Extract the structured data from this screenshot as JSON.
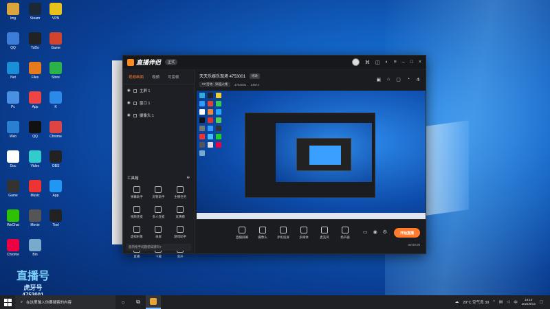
{
  "desktop": {
    "icons": [
      {
        "label": "Img",
        "color": "#d9a53c"
      },
      {
        "label": "Steam",
        "color": "#1b2838"
      },
      {
        "label": "VPN",
        "color": "#e8c21a"
      },
      {
        "label": "QQ",
        "color": "#3d7dd8"
      },
      {
        "label": "ToDo",
        "color": "#222"
      },
      {
        "label": "Game",
        "color": "#d4432c"
      },
      {
        "label": "Net",
        "color": "#1a8fd8"
      },
      {
        "label": "Files",
        "color": "#e87a1e"
      },
      {
        "label": "Store",
        "color": "#2bb34a"
      },
      {
        "label": "Pc",
        "color": "#4a90e2"
      },
      {
        "label": "App",
        "color": "#e44"
      },
      {
        "label": "K",
        "color": "#2b8ae8"
      },
      {
        "label": "Web",
        "color": "#2b7fd1"
      },
      {
        "label": "QQ",
        "color": "#111"
      },
      {
        "label": "Chrome",
        "color": "#d44"
      },
      {
        "label": "Doc",
        "color": "#fff"
      },
      {
        "label": "Video",
        "color": "#3cc"
      },
      {
        "label": "OBS",
        "color": "#222"
      },
      {
        "label": "Game",
        "color": "#333"
      },
      {
        "label": "Music",
        "color": "#e33"
      },
      {
        "label": "App",
        "color": "#2196f3"
      },
      {
        "label": "WeChat",
        "color": "#2dc100"
      },
      {
        "label": "Movie",
        "color": "#555"
      },
      {
        "label": "Tool",
        "color": "#222"
      },
      {
        "label": "Chrome",
        "color": "#e04"
      },
      {
        "label": "Bin",
        "color": "#7ac"
      }
    ]
  },
  "watermark": {
    "line1": "直播号",
    "line2": "虎牙号",
    "line3": "4753001"
  },
  "app": {
    "brand": "直播伴侣",
    "version_badge": "正式",
    "titlebar_icons": [
      "avatar",
      "gift",
      "bag",
      "skin",
      "menu",
      "min",
      "max",
      "close"
    ],
    "left_tabs": [
      "视频画面",
      "视频",
      "可变帧"
    ],
    "scenes": [
      "主屏 1",
      "窗口 1",
      "摄像头 1"
    ],
    "tools_title": "工具箱",
    "tools": [
      "弹幕助手",
      "房管助手",
      "主播任务",
      "视频连麦",
      "多人连麦",
      "竞猜模",
      "虚拟形象",
      "录屏",
      "游戏助手",
      "直播",
      "下载",
      "变声"
    ],
    "notice": "您的抢手问题您知道吗?",
    "room_title": "天天乐娱乐现场 4753001",
    "room_tag": "修改",
    "room_meta": {
      "category": "CF活动 · 穿越火线",
      "viewers": "4753001",
      "heat": "14974"
    },
    "controls": [
      "直播屏幕",
      "摄像头",
      "手机投屏",
      "多媒体",
      "麦克风",
      "扬声器"
    ],
    "start_label": "开始直播",
    "timer": "00:00:00"
  },
  "taskbar": {
    "search_placeholder": "在这里输入你要搜索的内容",
    "weather": "29°C 空气良 39",
    "time": "19:15",
    "date": "2021/9/13"
  }
}
